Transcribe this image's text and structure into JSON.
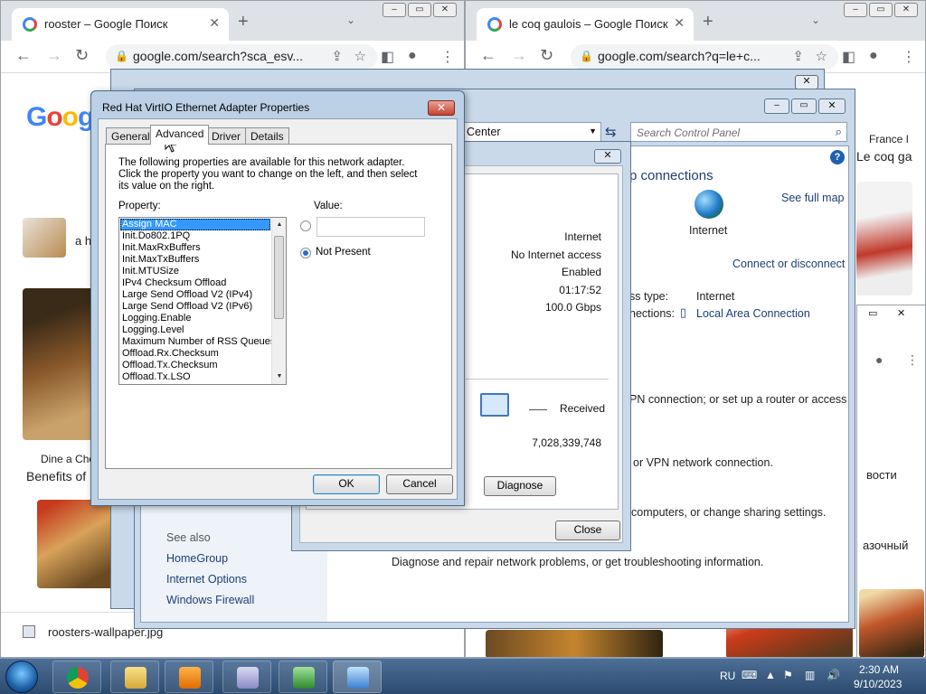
{
  "browser_left": {
    "tab_title": "rooster – Google Поиск",
    "url": "google.com/search?sca_esv...",
    "logo_text": "Goog",
    "snippet_a": "a h",
    "snippet_dine": "Dine a Cho",
    "snippet_benefits": "Benefits of",
    "download_file": "roosters-wallpaper.jpg"
  },
  "browser_right": {
    "tab_title": "le coq gaulois – Google Поиск",
    "url": "google.com/search?q=le+c...",
    "france_link": "France I",
    "result_text": "Le coq ga",
    "chip_1": "вости",
    "chip_2": "азочный"
  },
  "control_panel": {
    "address_crumb": "Center",
    "search_placeholder": "Search Control Panel",
    "heading_fragment": "p connections",
    "see_full_map": "See full map",
    "internet_label": "Internet",
    "connect_disconnect": "Connect or disconnect",
    "access_type_label": "ss type:",
    "access_type_value": "Internet",
    "connections_label": "nections:",
    "connection_link": "Local Area Connection",
    "task_1": "PN connection; or set up a router or access",
    "task_2": "or VPN network connection.",
    "task_3": "computers, or change sharing settings.",
    "task_4": "Diagnose and repair network problems, or get troubleshooting information.",
    "see_also": "See also",
    "see_also_links": [
      "HomeGroup",
      "Internet Options",
      "Windows Firewall"
    ]
  },
  "status_dialog": {
    "rows": [
      "Internet",
      "No Internet access",
      "Enabled",
      "01:17:52",
      "100.0 Gbps"
    ],
    "received_label": "Received",
    "received_value": "7,028,339,748",
    "diagnose_button": "Diagnose",
    "close_button": "Close"
  },
  "adapter_dialog": {
    "title": "Red Hat VirtIO Ethernet Adapter Properties",
    "tabs": [
      "General",
      "Advanced",
      "Driver",
      "Details"
    ],
    "active_tab": "Advanced",
    "description": "The following properties are available for this network adapter. Click the property you want to change on the left, and then select its value on the right.",
    "property_label": "Property:",
    "value_label": "Value:",
    "properties": [
      "Assign MAC",
      "Init.Do802.1PQ",
      "Init.MaxRxBuffers",
      "Init.MaxTxBuffers",
      "Init.MTUSize",
      "IPv4 Checksum Offload",
      "Large Send Offload V2 (IPv4)",
      "Large Send Offload V2 (IPv6)",
      "Logging.Enable",
      "Logging.Level",
      "Maximum Number of RSS Queues",
      "Offload.Rx.Checksum",
      "Offload.Tx.Checksum",
      "Offload.Tx.LSO"
    ],
    "selected_property": "Assign MAC",
    "value_input": "",
    "not_present_label": "Not Present",
    "not_present_selected": true,
    "ok_button": "OK",
    "cancel_button": "Cancel"
  },
  "taskbar": {
    "language": "RU",
    "time": "2:30 AM",
    "date": "9/10/2023"
  }
}
